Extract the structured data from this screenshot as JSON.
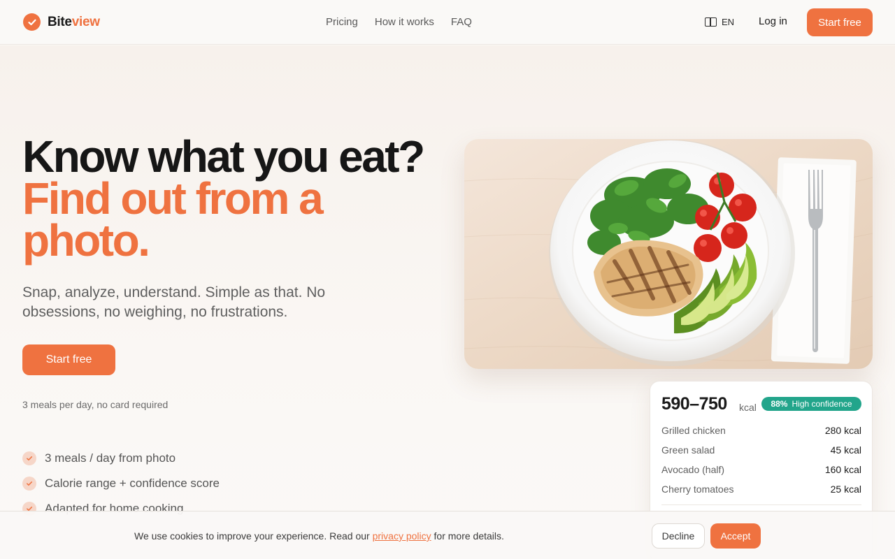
{
  "brand": {
    "name_part1": "Bite",
    "name_part2": "view",
    "accent": "#ef7240"
  },
  "nav": {
    "items": [
      "Pricing",
      "How it works",
      "FAQ"
    ]
  },
  "header": {
    "language": "EN",
    "login": "Log in",
    "start": "Start free"
  },
  "hero": {
    "title_line1": "Know what you eat?",
    "title_line2": "Find out from a photo.",
    "subtitle": "Snap, analyze, understand. Simple as that. No obsessions, no weighing, no frustrations.",
    "cta": "Start free",
    "note": "3 meals per day, no card required",
    "features": [
      "3 meals / day from photo",
      "Calorie range + confidence score",
      "Adapted for home cooking"
    ]
  },
  "result": {
    "kcal_range": "590–750",
    "kcal_unit": "kcal",
    "confidence_pct": "88%",
    "confidence_label": "High confidence",
    "confidence_color": "#22a58b",
    "items": [
      {
        "name": "Grilled chicken",
        "value": "280 kcal"
      },
      {
        "name": "Green salad",
        "value": "45 kcal"
      },
      {
        "name": "Avocado (half)",
        "value": "160 kcal"
      },
      {
        "name": "Cherry tomatoes",
        "value": "25 kcal"
      }
    ]
  },
  "cookie": {
    "text_before": "We use cookies to improve your experience. Read our",
    "link": "privacy policy",
    "text_after": "for more details.",
    "decline": "Decline",
    "accept": "Accept"
  }
}
